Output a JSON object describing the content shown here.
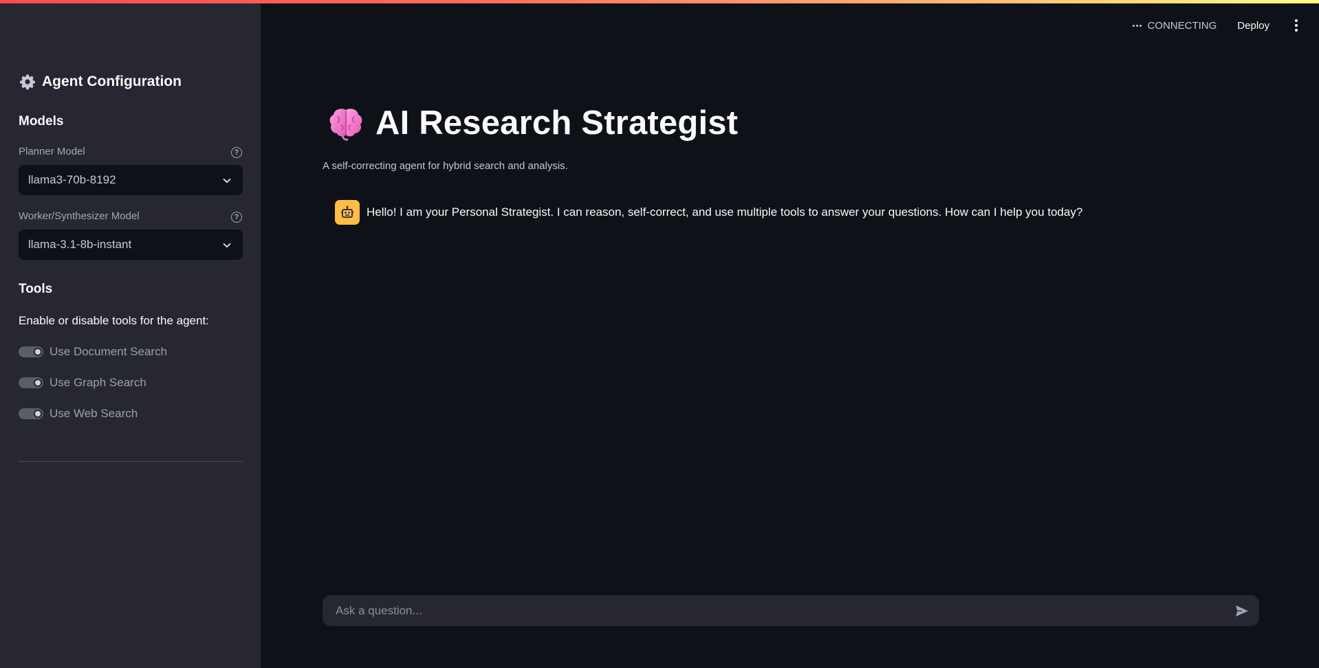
{
  "sidebar": {
    "title": "Agent Configuration",
    "models_heading": "Models",
    "planner": {
      "label": "Planner Model",
      "value": "llama3-70b-8192",
      "help": "?"
    },
    "worker": {
      "label": "Worker/Synthesizer Model",
      "value": "llama-3.1-8b-instant",
      "help": "?"
    },
    "tools_heading": "Tools",
    "tools_description": "Enable or disable tools for the agent:",
    "toggles": [
      {
        "label": "Use Document Search",
        "on": true
      },
      {
        "label": "Use Graph Search",
        "on": true
      },
      {
        "label": "Use Web Search",
        "on": true
      }
    ]
  },
  "header": {
    "status": "CONNECTING",
    "deploy_label": "Deploy"
  },
  "main": {
    "title": "AI Research Strategist",
    "caption": "A self-correcting agent for hybrid search and analysis.",
    "messages": [
      {
        "role": "assistant",
        "text": "Hello! I am your Personal Strategist. I can reason, self-correct, and use multiple tools to answer your questions. How can I help you today?"
      }
    ],
    "input_placeholder": "Ask a question..."
  },
  "colors": {
    "background": "#0e1117",
    "sidebar": "#262730",
    "avatar": "#ffbd45",
    "title_emoji": "#ff7fd1"
  },
  "icons": {
    "title": "brain-icon",
    "sidebar_title": "gear-icon",
    "avatar": "robot-icon",
    "send": "send-icon",
    "menu": "kebab-menu-icon"
  }
}
